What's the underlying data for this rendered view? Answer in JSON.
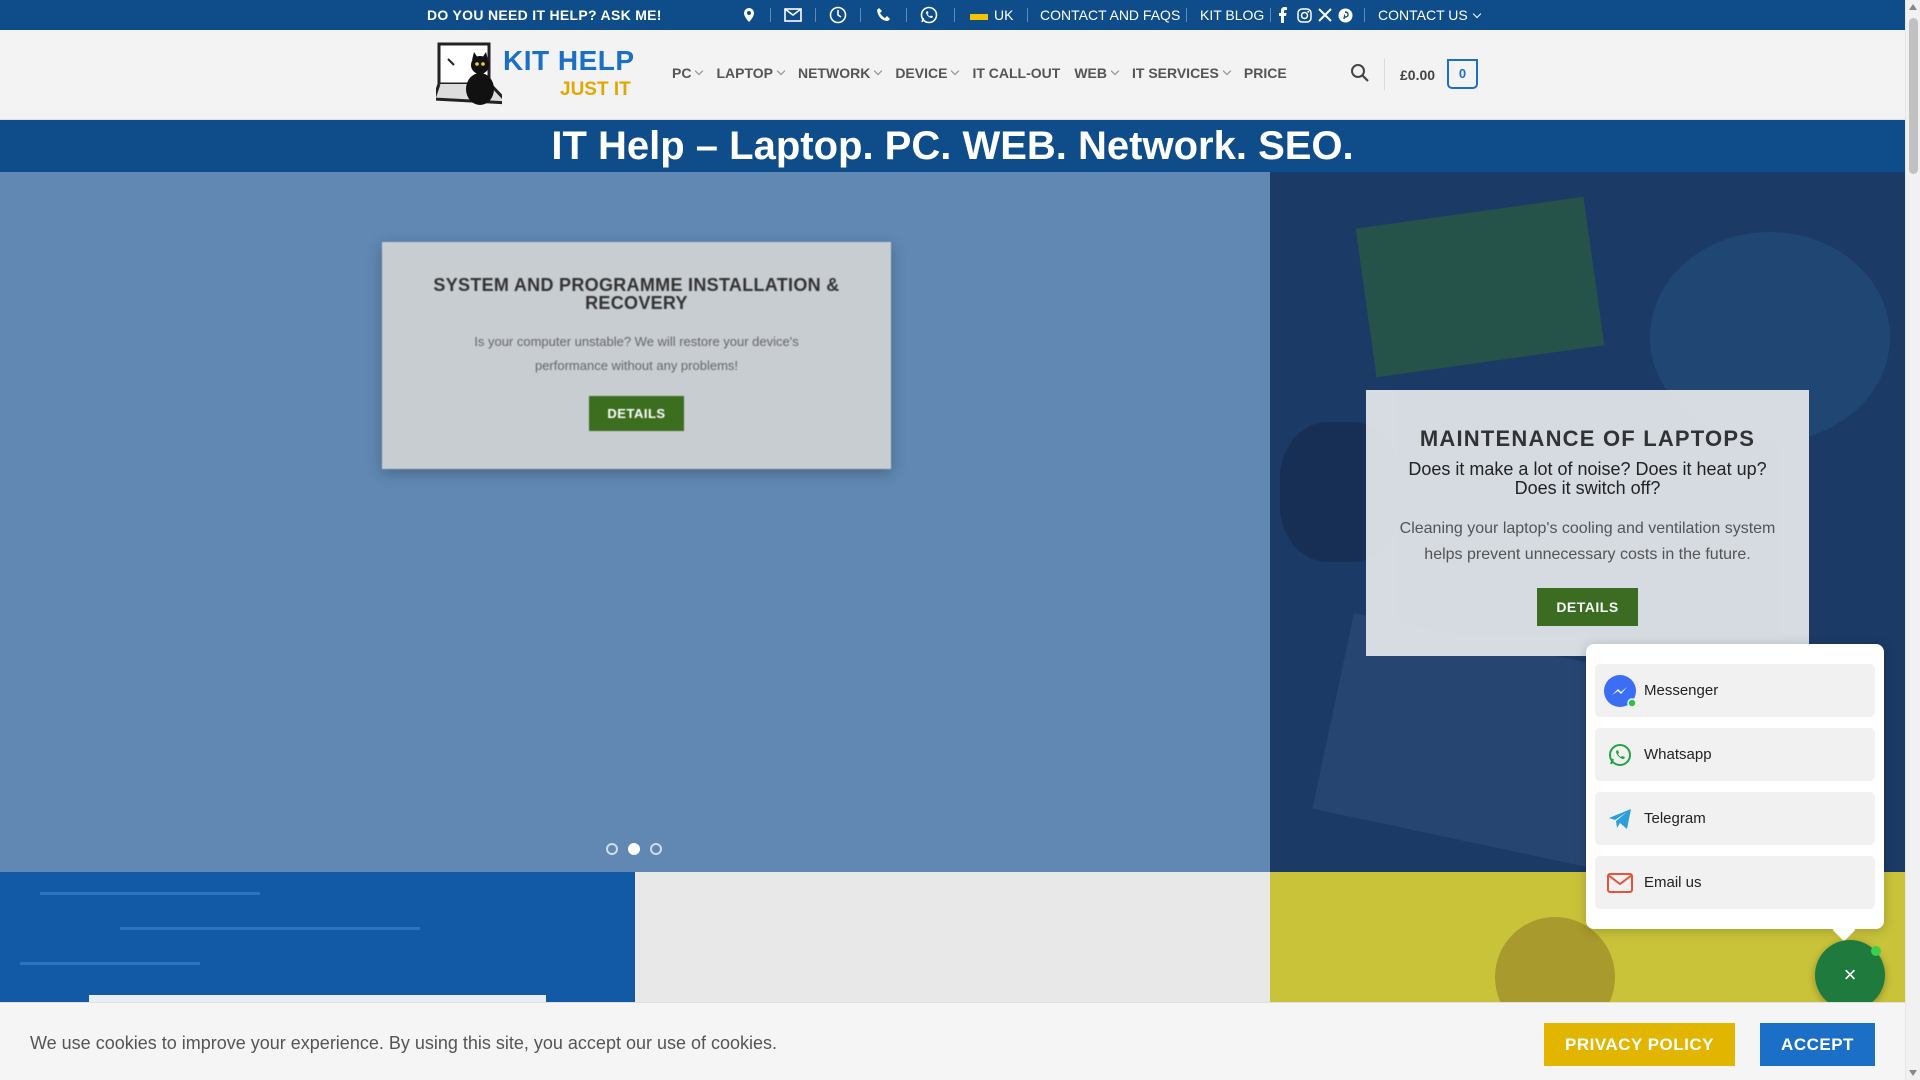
{
  "topbar": {
    "ask": "DO YOU NEED IT HELP? ASK ME!",
    "icons": [
      "location-icon",
      "mail-icon",
      "clock-icon",
      "phone-icon",
      "whatsapp-icon"
    ],
    "lang": "UK",
    "contact_faqs": "CONTACT AND FAQS",
    "blog": "KIT BLOG",
    "social": [
      "facebook-icon",
      "instagram-icon",
      "x-icon",
      "pinterest-icon"
    ],
    "contact_us": "CONTACT US"
  },
  "logo": {
    "name": "KIT HELP",
    "sub": "JUST IT"
  },
  "nav": {
    "items": [
      {
        "label": "PC",
        "dropdown": true
      },
      {
        "label": "LAPTOP",
        "dropdown": true
      },
      {
        "label": "NETWORK",
        "dropdown": true
      },
      {
        "label": "DEVICE",
        "dropdown": true
      },
      {
        "label": "IT CALL-OUT",
        "dropdown": false
      },
      {
        "label": "WEB",
        "dropdown": true
      },
      {
        "label": "IT SERVICES",
        "dropdown": true
      },
      {
        "label": "PRICE",
        "dropdown": false
      }
    ]
  },
  "cart": {
    "amount": "£0.00",
    "count": "0"
  },
  "banner": {
    "title": "IT Help – Laptop. PC. WEB. Network. SEO."
  },
  "slide1": {
    "title": "SYSTEM AND PROGRAMME INSTALLATION & RECOVERY",
    "text": "Is your computer unstable? We will restore your device's performance without any problems!",
    "button": "DETAILS"
  },
  "slide2": {
    "title": "MAINTENANCE OF LAPTOPS",
    "subtitle": "Does it make a lot of noise? Does it heat up? Does it switch off?",
    "text": "Cleaning your laptop's cooling and ventilation system helps prevent unnecessary costs in the future.",
    "button": "DETAILS"
  },
  "slider": {
    "active_index": 1,
    "count": 3
  },
  "chat": {
    "items": [
      {
        "label": "Messenger",
        "icon": "messenger-icon"
      },
      {
        "label": "Whatsapp",
        "icon": "whatsapp-icon"
      },
      {
        "label": "Telegram",
        "icon": "telegram-icon"
      },
      {
        "label": "Email us",
        "icon": "email-icon"
      }
    ],
    "close": "×"
  },
  "cookie": {
    "message": "We use cookies to improve your experience. By using this site, you accept our use of cookies.",
    "privacy": "PRIVACY POLICY",
    "accept": "ACCEPT"
  },
  "colors": {
    "primary": "#0f4d8a",
    "accent": "#1b6fc7",
    "green": "#3c6e20",
    "yellow": "#e2b500"
  }
}
